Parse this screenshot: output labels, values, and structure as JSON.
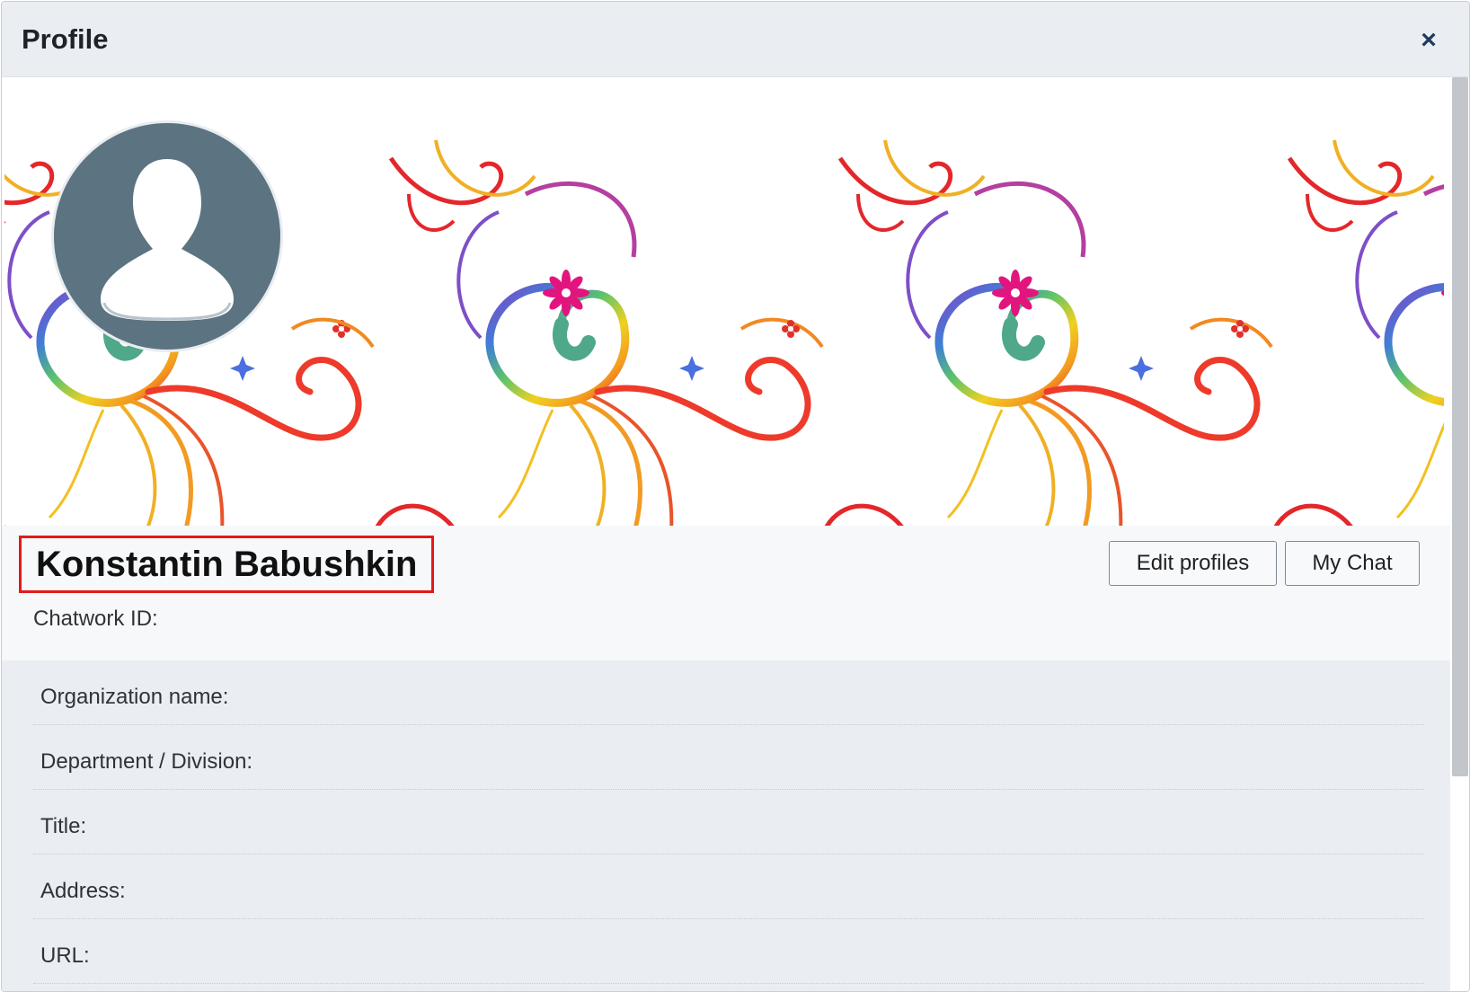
{
  "dialog": {
    "title": "Profile",
    "close_label": "×"
  },
  "profile": {
    "name": "Konstantin Babushkin",
    "chatwork_id_label": "Chatwork ID:"
  },
  "actions": {
    "edit_label": "Edit profiles",
    "chat_label": "My Chat"
  },
  "details": [
    {
      "label": "Organization name:"
    },
    {
      "label": "Department / Division:"
    },
    {
      "label": "Title:"
    },
    {
      "label": "Address:"
    },
    {
      "label": "URL:"
    }
  ],
  "colors": {
    "header_bg": "#eaeef2",
    "highlight_border": "#e21a1a",
    "avatar_bg": "#5c7382",
    "close_icon": "#1e3a5f"
  },
  "icons": {
    "close": "close-icon",
    "avatar": "user-silhouette-icon"
  }
}
